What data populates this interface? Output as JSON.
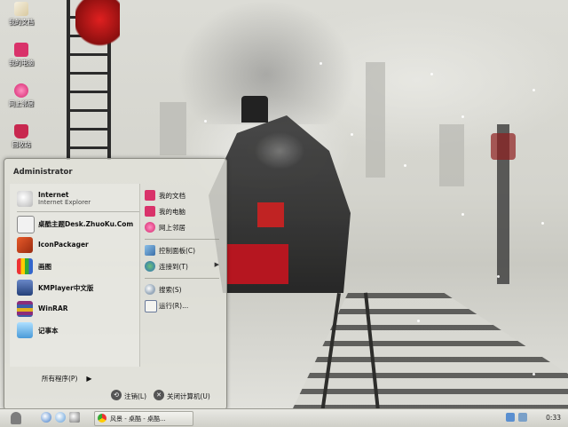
{
  "desktop": {
    "icons": [
      {
        "label": "我的文档"
      },
      {
        "label": "我的电脑"
      },
      {
        "label": "网上邻居"
      },
      {
        "label": "回收站"
      }
    ]
  },
  "start_menu": {
    "user_name": "Administrator",
    "pinned": [
      {
        "title": "Internet",
        "subtitle": "Internet Explorer"
      },
      {
        "title": "桌酷主题Desk.ZhuoKu.Com"
      },
      {
        "title": "IconPackager"
      },
      {
        "title": "画图"
      },
      {
        "title": "KMPlayer中文版"
      },
      {
        "title": "WinRAR"
      },
      {
        "title": "记事本"
      }
    ],
    "all_programs": "所有程序(P)",
    "all_programs_arrow": "▶",
    "right_items": [
      {
        "label": "我的文档"
      },
      {
        "label": "我的电脑"
      },
      {
        "label": "网上邻居"
      },
      {
        "label": "控制面板(C)"
      },
      {
        "label": "连接到(T)",
        "submenu_arrow": "▶"
      },
      {
        "label": "搜索(S)"
      },
      {
        "label": "运行(R)..."
      }
    ],
    "logoff": "注销(L)",
    "shutdown": "关闭计算机(U)"
  },
  "taskbar": {
    "task_label": "风景 - 桌酷 - 桌酷...",
    "clock": "0:33"
  },
  "colors": {
    "accent_red": "#c5141f",
    "taskbar_bg": "#d8d8d2",
    "menu_bg": "#e2e2da"
  }
}
